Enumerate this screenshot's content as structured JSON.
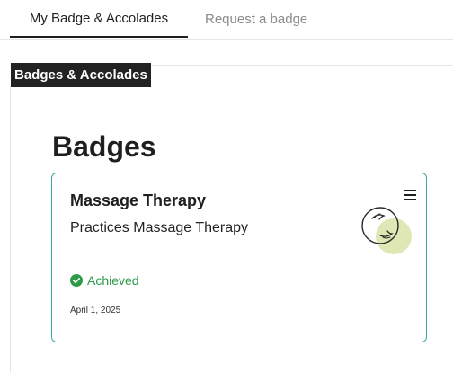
{
  "tabs": [
    {
      "label": "My Badge & Accolades",
      "active": true
    },
    {
      "label": "Request a badge",
      "active": false
    }
  ],
  "section_label": "Badges & Accolades",
  "page_title": "Badges",
  "card": {
    "title": "Massage Therapy",
    "description": "Practices Massage Therapy",
    "status": "Achieved",
    "date": "April 1, 2025",
    "menu_icon": "hamburger-menu-icon",
    "badge_icon": "massage-hands-icon"
  },
  "colors": {
    "card_border": "#3aa8a0",
    "status_green": "#2e9b49",
    "badge_circle": "#dfe8b4",
    "section_label_bg": "#222222"
  }
}
